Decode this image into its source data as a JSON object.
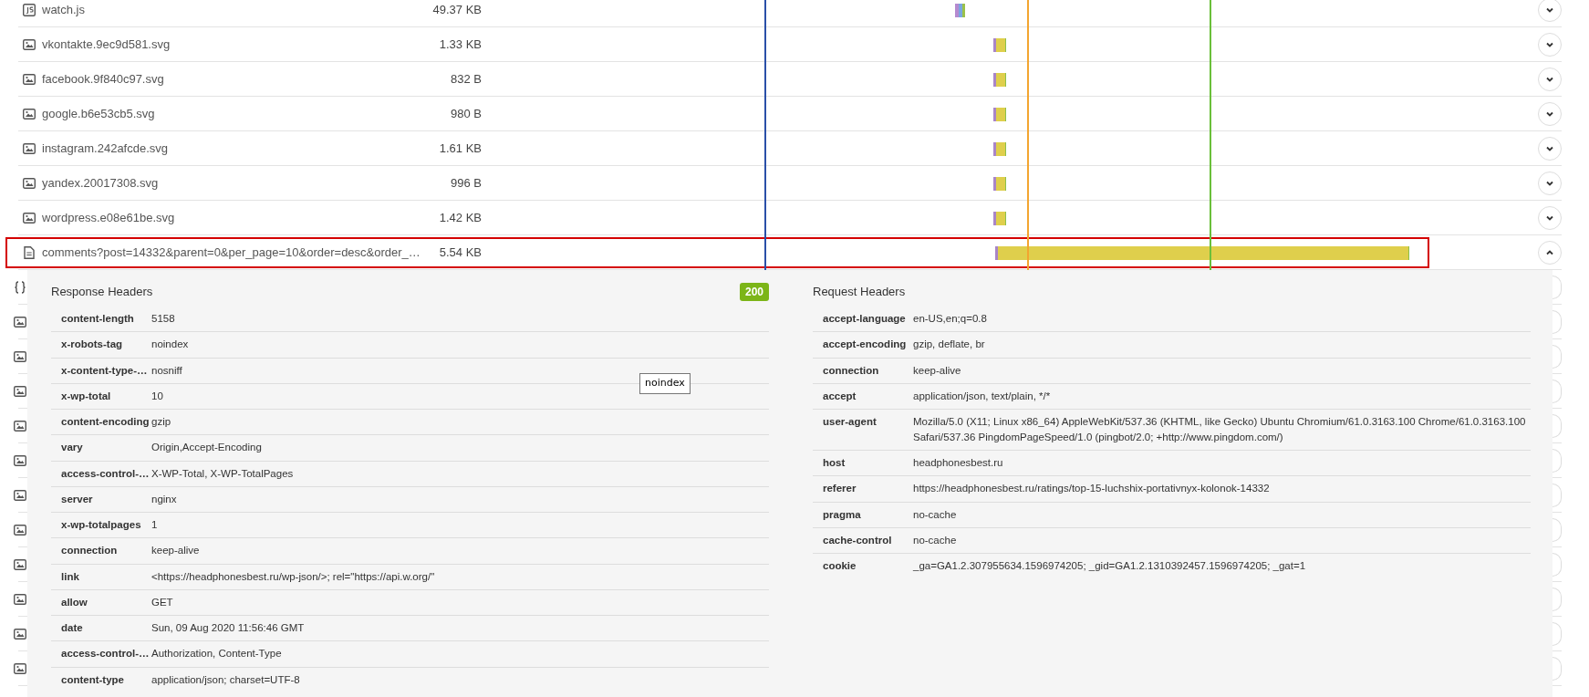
{
  "requests": [
    {
      "kind": "js",
      "name": "watch.js",
      "size": "49.37 KB",
      "expanded": false,
      "selected": false
    },
    {
      "kind": "image",
      "name": "vkontakte.9ec9d581.svg",
      "size": "1.33 KB",
      "expanded": false,
      "selected": false
    },
    {
      "kind": "image",
      "name": "facebook.9f840c97.svg",
      "size": "832 B",
      "expanded": false,
      "selected": false
    },
    {
      "kind": "image",
      "name": "google.b6e53cb5.svg",
      "size": "980 B",
      "expanded": false,
      "selected": false
    },
    {
      "kind": "image",
      "name": "instagram.242afcde.svg",
      "size": "1.61 KB",
      "expanded": false,
      "selected": false
    },
    {
      "kind": "image",
      "name": "yandex.20017308.svg",
      "size": "996 B",
      "expanded": false,
      "selected": false
    },
    {
      "kind": "image",
      "name": "wordpress.e08e61be.svg",
      "size": "1.42 KB",
      "expanded": false,
      "selected": false
    },
    {
      "kind": "document",
      "name": "comments?post=14332&parent=0&per_page=10&order=desc&order_…",
      "size": "5.54 KB",
      "expanded": true,
      "selected": true
    }
  ],
  "hidden_rows": [
    {
      "kind": "json"
    },
    {
      "kind": "image"
    },
    {
      "kind": "image"
    },
    {
      "kind": "image"
    },
    {
      "kind": "image"
    },
    {
      "kind": "image"
    },
    {
      "kind": "image"
    },
    {
      "kind": "image"
    },
    {
      "kind": "image"
    },
    {
      "kind": "image"
    },
    {
      "kind": "image"
    },
    {
      "kind": "image"
    }
  ],
  "details": {
    "response": {
      "title": "Response Headers",
      "status": "200",
      "headers": [
        {
          "key": "content-length",
          "value": "5158"
        },
        {
          "key": "x-robots-tag",
          "value": "noindex"
        },
        {
          "key": "x-content-type-…",
          "value": "nosniff"
        },
        {
          "key": "x-wp-total",
          "value": "10"
        },
        {
          "key": "content-encoding",
          "value": "gzip"
        },
        {
          "key": "vary",
          "value": "Origin,Accept-Encoding"
        },
        {
          "key": "access-control-…",
          "value": "X-WP-Total, X-WP-TotalPages"
        },
        {
          "key": "server",
          "value": "nginx"
        },
        {
          "key": "x-wp-totalpages",
          "value": "1"
        },
        {
          "key": "connection",
          "value": "keep-alive"
        },
        {
          "key": "link",
          "value": "<https://headphonesbest.ru/wp-json/>; rel=\"https://api.w.org/\""
        },
        {
          "key": "allow",
          "value": "GET"
        },
        {
          "key": "date",
          "value": "Sun, 09 Aug 2020 11:56:46 GMT"
        },
        {
          "key": "access-control-…",
          "value": "Authorization, Content-Type"
        },
        {
          "key": "content-type",
          "value": "application/json; charset=UTF-8"
        }
      ]
    },
    "request": {
      "title": "Request Headers",
      "headers": [
        {
          "key": "accept-language",
          "value": "en-US,en;q=0.8"
        },
        {
          "key": "accept-encoding",
          "value": "gzip, deflate, br"
        },
        {
          "key": "connection",
          "value": "keep-alive"
        },
        {
          "key": "accept",
          "value": "application/json, text/plain, */*"
        },
        {
          "key": "user-agent",
          "value": "Mozilla/5.0 (X11; Linux x86_64) AppleWebKit/537.36 (KHTML, like Gecko) Ubuntu Chromium/61.0.3163.100 Chrome/61.0.3163.100 Safari/537.36 PingdomPageSpeed/1.0 (pingbot/2.0; +http://www.pingdom.com/)"
        },
        {
          "key": "host",
          "value": "headphonesbest.ru"
        },
        {
          "key": "referer",
          "value": "https://headphonesbest.ru/ratings/top-15-luchshix-portativnyx-kolonok-14332"
        },
        {
          "key": "pragma",
          "value": "no-cache"
        },
        {
          "key": "cache-control",
          "value": "no-cache"
        },
        {
          "key": "cookie",
          "value": "_ga=GA1.2.307955634.1596974205; _gid=GA1.2.1310392457.1596974205; _gat=1"
        }
      ]
    },
    "tooltip": "noindex"
  }
}
